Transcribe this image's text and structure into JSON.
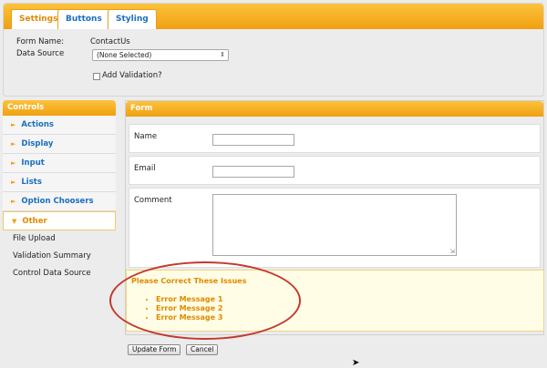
{
  "tabs": [
    {
      "label": "Settings",
      "active": true
    },
    {
      "label": "Buttons",
      "active": false
    },
    {
      "label": "Styling",
      "active": false
    }
  ],
  "settings": {
    "form_name_label": "Form Name:",
    "form_name_value": "ContactUs",
    "data_source_label": "Data Source",
    "data_source_value": "(None Selected)",
    "add_validation_label": "Add Validation?",
    "add_validation_checked": false
  },
  "controls": {
    "header": "Controls",
    "groups": [
      {
        "label": "Actions",
        "open": false
      },
      {
        "label": "Display",
        "open": false
      },
      {
        "label": "Input",
        "open": false
      },
      {
        "label": "Lists",
        "open": false
      },
      {
        "label": "Option Choosers",
        "open": false
      },
      {
        "label": "Other",
        "open": true
      }
    ],
    "other_items": [
      "File Upload",
      "Validation Summary",
      "Control Data Source"
    ]
  },
  "form": {
    "header": "Form",
    "fields": [
      {
        "label": "Name",
        "value": ""
      },
      {
        "label": "Email",
        "value": ""
      },
      {
        "label": "Comment",
        "value": ""
      }
    ],
    "validation": {
      "title": "Please Correct These Issues",
      "messages": [
        "Error Message 1",
        "Error Message 2",
        "Error Message 3"
      ]
    }
  },
  "buttons": {
    "update": "Update Form",
    "cancel": "Cancel"
  },
  "colors": {
    "accent": "#f0a010",
    "link": "#1a6fbf",
    "error": "#e08a00",
    "highlight": "#c3392e"
  }
}
